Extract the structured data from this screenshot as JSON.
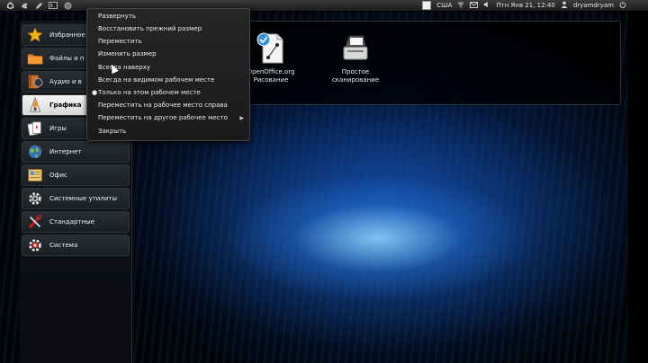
{
  "top_panel": {
    "keyboard_layout": "США",
    "datetime": "Птн Янв 21, 12:40",
    "username": "dryamdryam"
  },
  "launcher": {
    "categories": [
      {
        "label": "Избранное",
        "icon": "star-icon"
      },
      {
        "label": "Файлы и п",
        "icon": "folder-icon"
      },
      {
        "label": "Аудио и в",
        "icon": "media-icon"
      },
      {
        "label": "Графика",
        "icon": "graphics-icon"
      },
      {
        "label": "Игры",
        "icon": "cards-icon"
      },
      {
        "label": "Интернет",
        "icon": "globe-icon"
      },
      {
        "label": "Офис",
        "icon": "office-icon"
      },
      {
        "label": "Системные утилиты",
        "icon": "gear-icon"
      },
      {
        "label": "Стандартные",
        "icon": "tools-icon"
      },
      {
        "label": "Система",
        "icon": "system-gear-icon"
      }
    ]
  },
  "apps": [
    {
      "label_line1": "OpenOffice.org",
      "label_line2": "Рисование",
      "icon": "openoffice-draw-icon"
    },
    {
      "label_line1": "Простое",
      "label_line2": "сканирование",
      "icon": "scanner-icon"
    }
  ],
  "context_menu": {
    "items": [
      {
        "label": "Развернуть"
      },
      {
        "label": "Восстановить прежний размер"
      },
      {
        "label": "Переместить"
      },
      {
        "label": "Изменить размер"
      },
      {
        "label": "Всегда наверху"
      },
      {
        "label": "Всегда на видимом рабочем месте"
      },
      {
        "label": "Только на этом рабочем месте"
      },
      {
        "label": "Переместить на рабочее место справа"
      },
      {
        "label": "Переместить на другое рабочее место"
      },
      {
        "label": "Закрыть"
      }
    ]
  }
}
